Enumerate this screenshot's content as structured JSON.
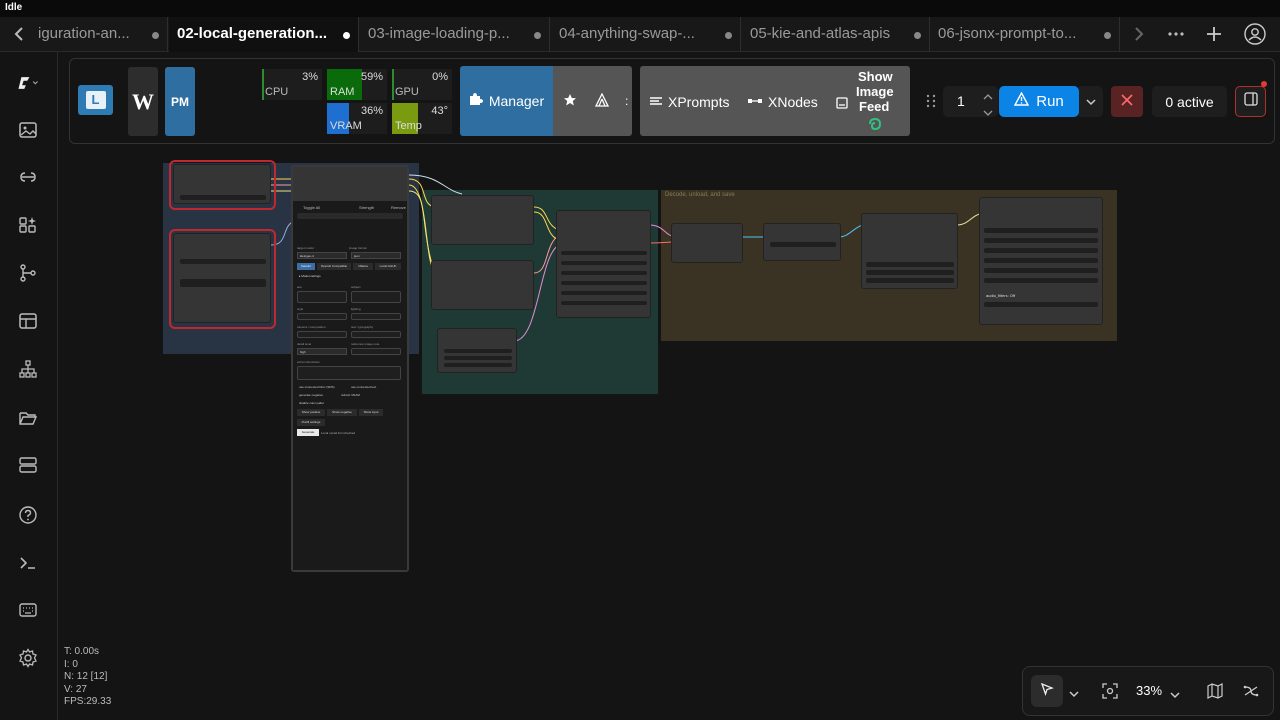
{
  "window": {
    "title": "Idle"
  },
  "tabs": [
    {
      "label": "iguration-an..."
    },
    {
      "label": "02-local-generation..."
    },
    {
      "label": "03-image-loading-p..."
    },
    {
      "label": "04-anything-swap-..."
    },
    {
      "label": "05-kie-and-atlas-apis"
    },
    {
      "label": "06-jsonx-prompt-to..."
    }
  ],
  "toolbar": {
    "badge_l": "L",
    "badge_w": "W",
    "badge_pm": "PM",
    "monitors": [
      {
        "label": "CPU",
        "value": "3%",
        "level": 0.03,
        "color": "#2e8b2e"
      },
      {
        "label": "RAM",
        "value": "59%",
        "level": 0.59,
        "color": "#0a6b0a"
      },
      {
        "label": "GPU",
        "value": "0%",
        "level": 0.0,
        "color": "#2e8b2e"
      },
      {
        "label": "VRAM",
        "value": "36%",
        "level": 0.36,
        "color": "#1e6fd0"
      },
      {
        "label": "Temp",
        "value": "43°",
        "level": 0.43,
        "color": "#7a9a10"
      }
    ],
    "manager_label": "Manager",
    "xprompts_label": "XPrompts",
    "xnodes_label": "XNodes",
    "feed_label_1": "Show",
    "feed_label_2": "Image",
    "feed_label_3": "Feed",
    "batch_count": "1",
    "run_label": "Run",
    "active_label": "0 active",
    "accent_color": "#0b84e6"
  },
  "canvas": {
    "group_decode_title": "Decode, unload, and save",
    "panel": {
      "toggle_all": "Toggle All",
      "strength": "Strength",
      "remove": "Remove",
      "target_model": "target model",
      "target_model_value": "kleingen-4",
      "image_format": "image format",
      "image_format_value": "json",
      "btn_gemini": "Gemini",
      "btn_openai": "OpenAI Compatible",
      "btn_ollama": "Ollama",
      "btn_local": "Local GGUF",
      "model_settings": "▸ Model settings",
      "l_aux": "aux",
      "l_subject": "subject",
      "l_style": "style",
      "l_lighting": "lighting",
      "l_camera": "camera / composition",
      "l_text": "text / typography",
      "l_detail": "detail level",
      "l_reference": "reference image note",
      "detail_value": "high",
      "l_extra": "extra instructions",
      "cb1": "use connected hlinx (SDS)",
      "cb2": "use connected text",
      "cb3": "generate negative",
      "cb4": "refresh VRAM",
      "cb5": "disable color pallet",
      "b_show_pos": "Show positive",
      "b_show_neg": "Show negative",
      "b_show_input": "Show input",
      "b_prefill": "Prefill settings",
      "b_generate": "Generate",
      "status": "Local model list refreshed"
    },
    "audio_label": "audio_filters: Off"
  },
  "stats": {
    "t": "T: 0.00s",
    "i": "I: 0",
    "n": "N: 12 [12]",
    "v": "V: 27",
    "fps": "FPS:29.33"
  },
  "zoom": {
    "value": "33%"
  }
}
